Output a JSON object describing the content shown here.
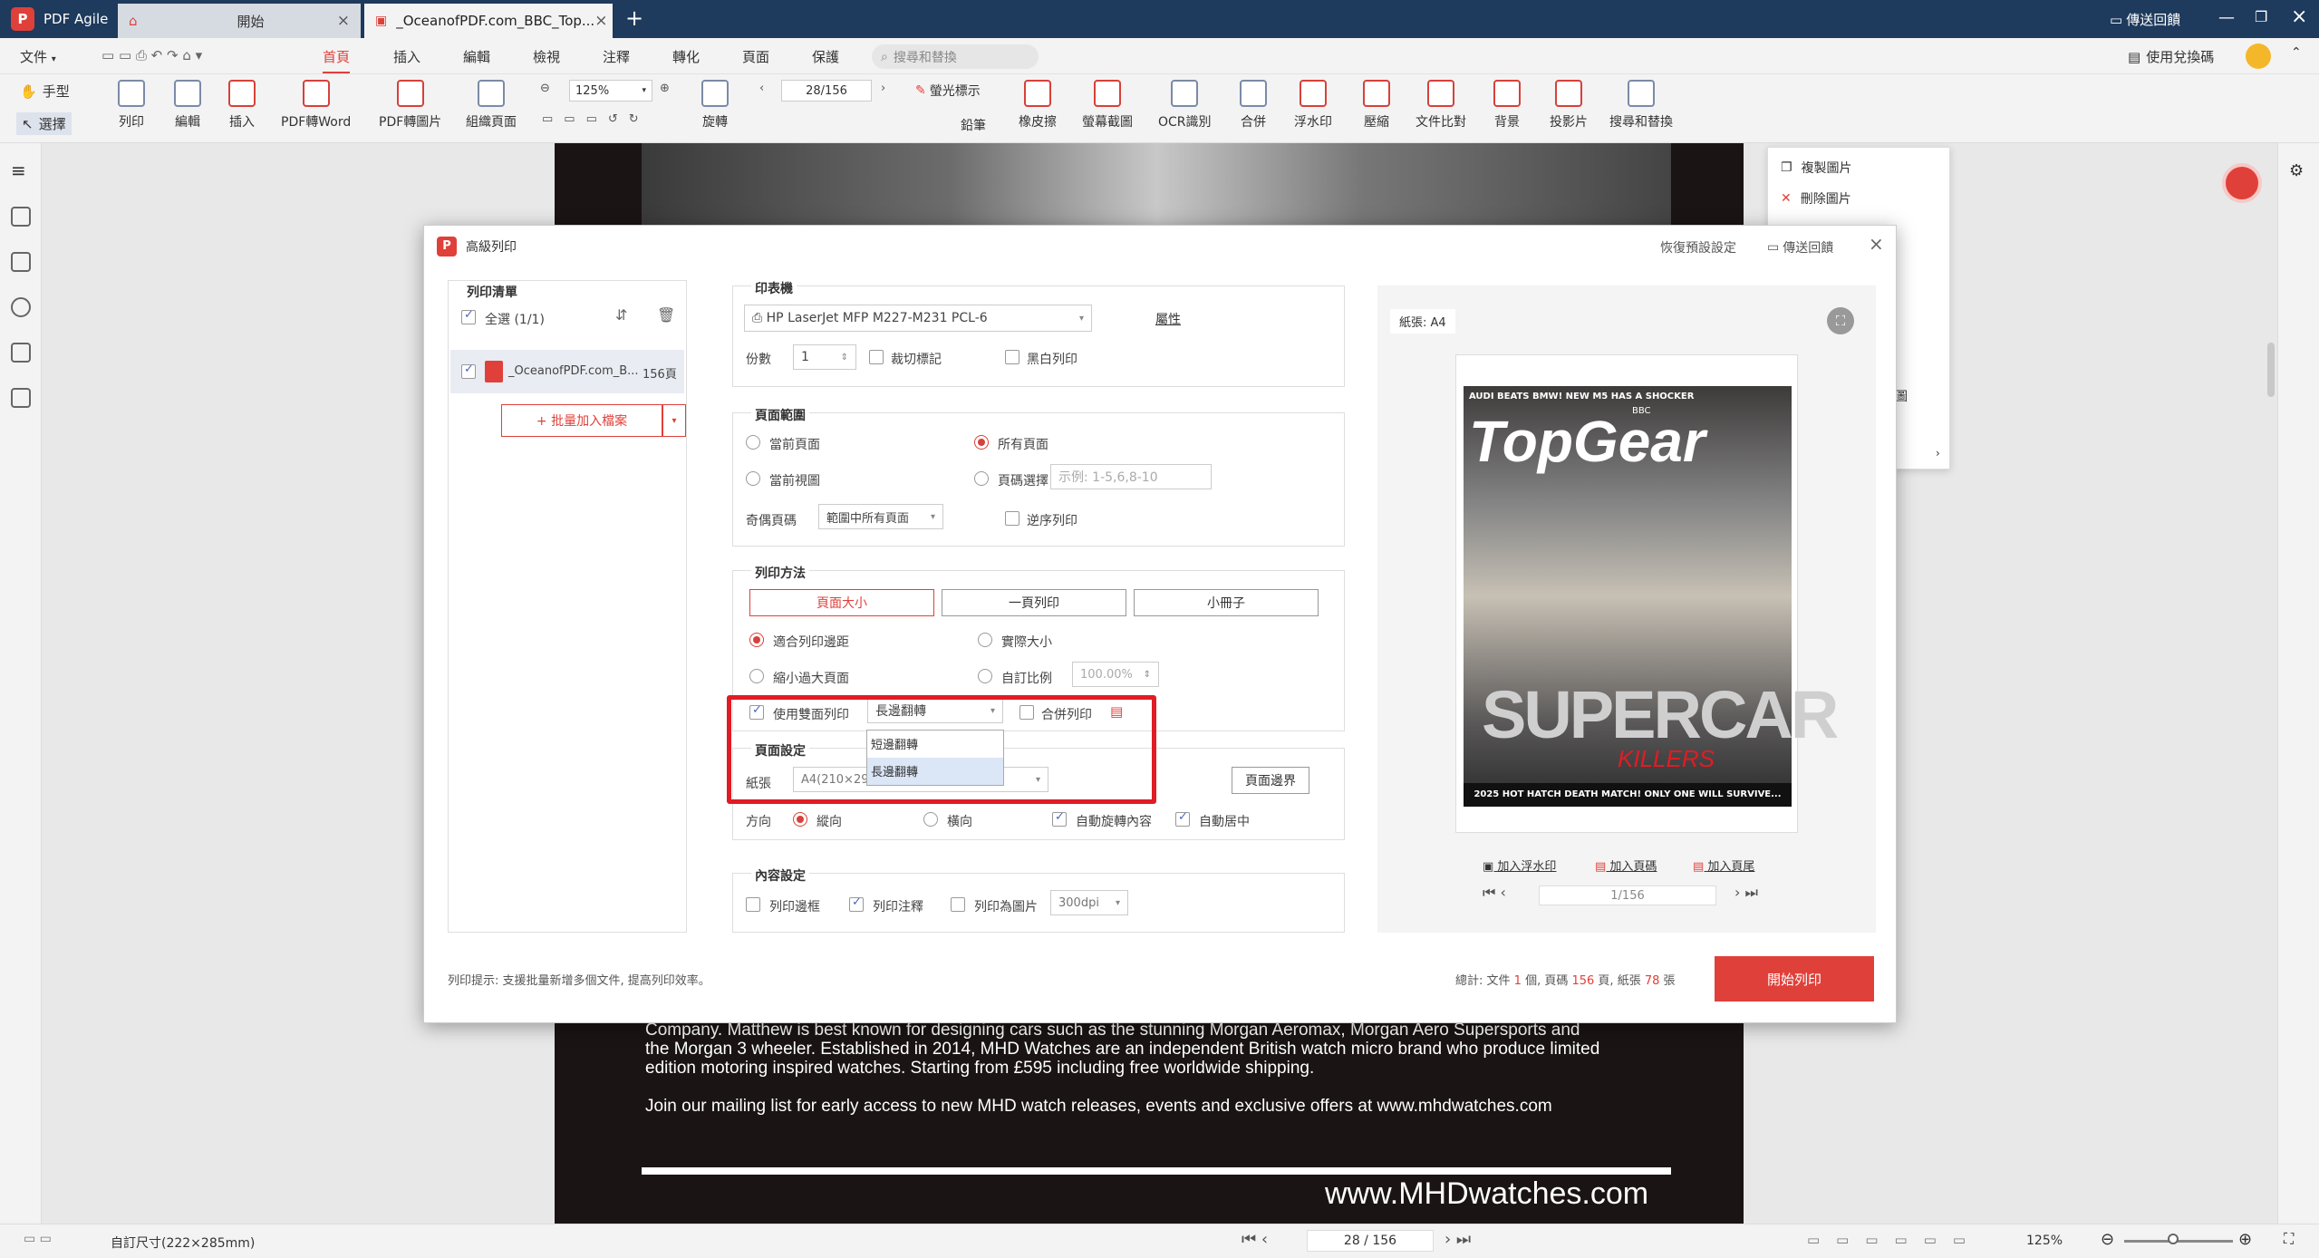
{
  "app": {
    "name": "PDF Agile",
    "send_feedback": "傳送回饋",
    "redeem": "使用兌換碼"
  },
  "tabs": [
    {
      "label": "開始"
    },
    {
      "label": "_OceanofPDF.com_BBC_Top..."
    }
  ],
  "menu": {
    "file": "文件",
    "items": [
      "首頁",
      "插入",
      "編輯",
      "檢視",
      "注釋",
      "轉化",
      "頁面",
      "保護"
    ],
    "search_placeholder": "搜尋和替換"
  },
  "ribbon": {
    "hand": "手型",
    "select": "選擇",
    "tools": [
      "列印",
      "編輯",
      "插入",
      "PDF轉Word",
      "PDF轉圖片",
      "組織頁面",
      "旋轉",
      "橡皮擦",
      "螢幕截圖",
      "OCR識別",
      "合併",
      "浮水印",
      "壓縮",
      "文件比對",
      "背景",
      "投影片",
      "搜尋和替換"
    ],
    "zoom": "125%",
    "page": "28/156",
    "highlight": "螢光標示",
    "hand2": "鉛筆"
  },
  "context_menu": {
    "items": [
      "複製圖片",
      "刪除圖片"
    ],
    "partial": "圖"
  },
  "dialog": {
    "title": "高級列印",
    "reset": "恢復預設設定",
    "feedback": "傳送回饋",
    "list": {
      "title": "列印清單",
      "select_all": "全選 (1/1)",
      "file_name": "_OceanofPDF.com_B...",
      "file_pages": "156頁",
      "batch_add": "+ 批量加入檔案"
    },
    "printer": {
      "title": "印表機",
      "name": "HP LaserJet MFP M227-M231 PCL-6",
      "properties": "屬性",
      "copies_label": "份數",
      "copies": "1",
      "crop_marks": "裁切標記",
      "bw": "黑白列印"
    },
    "range": {
      "title": "頁面範圍",
      "current_page": "當前頁面",
      "all_pages": "所有頁面",
      "current_view": "當前視圖",
      "page_select": "頁碼選擇",
      "page_placeholder": "示例: 1-5,6,8-10",
      "odd_even_label": "奇偶頁碼",
      "odd_even": "範圍中所有頁面",
      "reverse": "逆序列印"
    },
    "method": {
      "title": "列印方法",
      "modes": [
        "頁面大小",
        "一頁列印",
        "小冊子"
      ],
      "fit": "適合列印邊距",
      "actual": "實際大小",
      "shrink": "縮小過大頁面",
      "custom": "自訂比例",
      "custom_val": "100.00%",
      "duplex": "使用雙面列印",
      "flip": "長邊翻轉",
      "flip_options": [
        "短邊翻轉",
        "長邊翻轉"
      ],
      "combine": "合併列印"
    },
    "page_setup": {
      "title": "頁面設定",
      "paper_label": "紙張",
      "paper": "A4(210×297mm)",
      "bounds": "頁面邊界",
      "orient_label": "方向",
      "portrait": "縱向",
      "landscape": "橫向",
      "auto_rotate": "自動旋轉內容",
      "auto_center": "自動居中"
    },
    "content": {
      "title": "內容設定",
      "border": "列印邊框",
      "annot": "列印注釋",
      "image": "列印為圖片",
      "dpi": "300dpi"
    },
    "preview": {
      "paper": "紙張: A4",
      "add_watermark": "加入浮水印",
      "add_header": "加入頁碼",
      "add_footer": "加入頁尾",
      "page": "1/156"
    },
    "hint": "列印提示: 支援批量新增多個文件, 提高列印效率。",
    "summary": {
      "prefix": "總計: 文件 ",
      "files": "1",
      "mid1": " 個, 頁碼 ",
      "pages": "156",
      "mid2": " 頁, 紙張 ",
      "sheets": "78",
      "suffix": " 張"
    },
    "start": "開始列印"
  },
  "cover": {
    "top": "AUDI BEATS BMW! NEW M5 HAS A SHOCKER",
    "bbc": "BBC",
    "brand": "TopGear",
    "headline": "SUPERCAR",
    "killers": "KILLERS",
    "strap": "2025 HOT HATCH DEATH MATCH! ONLY ONE WILL SURVIVE..."
  },
  "doc_text": {
    "p1": "Company.  Matthew is best known for designing cars such as the stunning Morgan Aeromax, Morgan Aero Supersports and the Morgan 3 wheeler.  Established in 2014, MHD Watches are an independent British watch micro brand who produce limited edition motoring inspired watches. Starting from £595 including free worldwide shipping.",
    "p2": "Join our mailing list for early access to new MHD watch releases, events and exclusive offers at www.mhdwatches.com",
    "url": "www.MHDwatches.com"
  },
  "status": {
    "size": "自訂尺寸(222×285mm)",
    "page": "28 / 156",
    "zoom": "125%"
  },
  "colors": {
    "accent": "#e0403a",
    "titlebar": "#1e3a5c"
  }
}
